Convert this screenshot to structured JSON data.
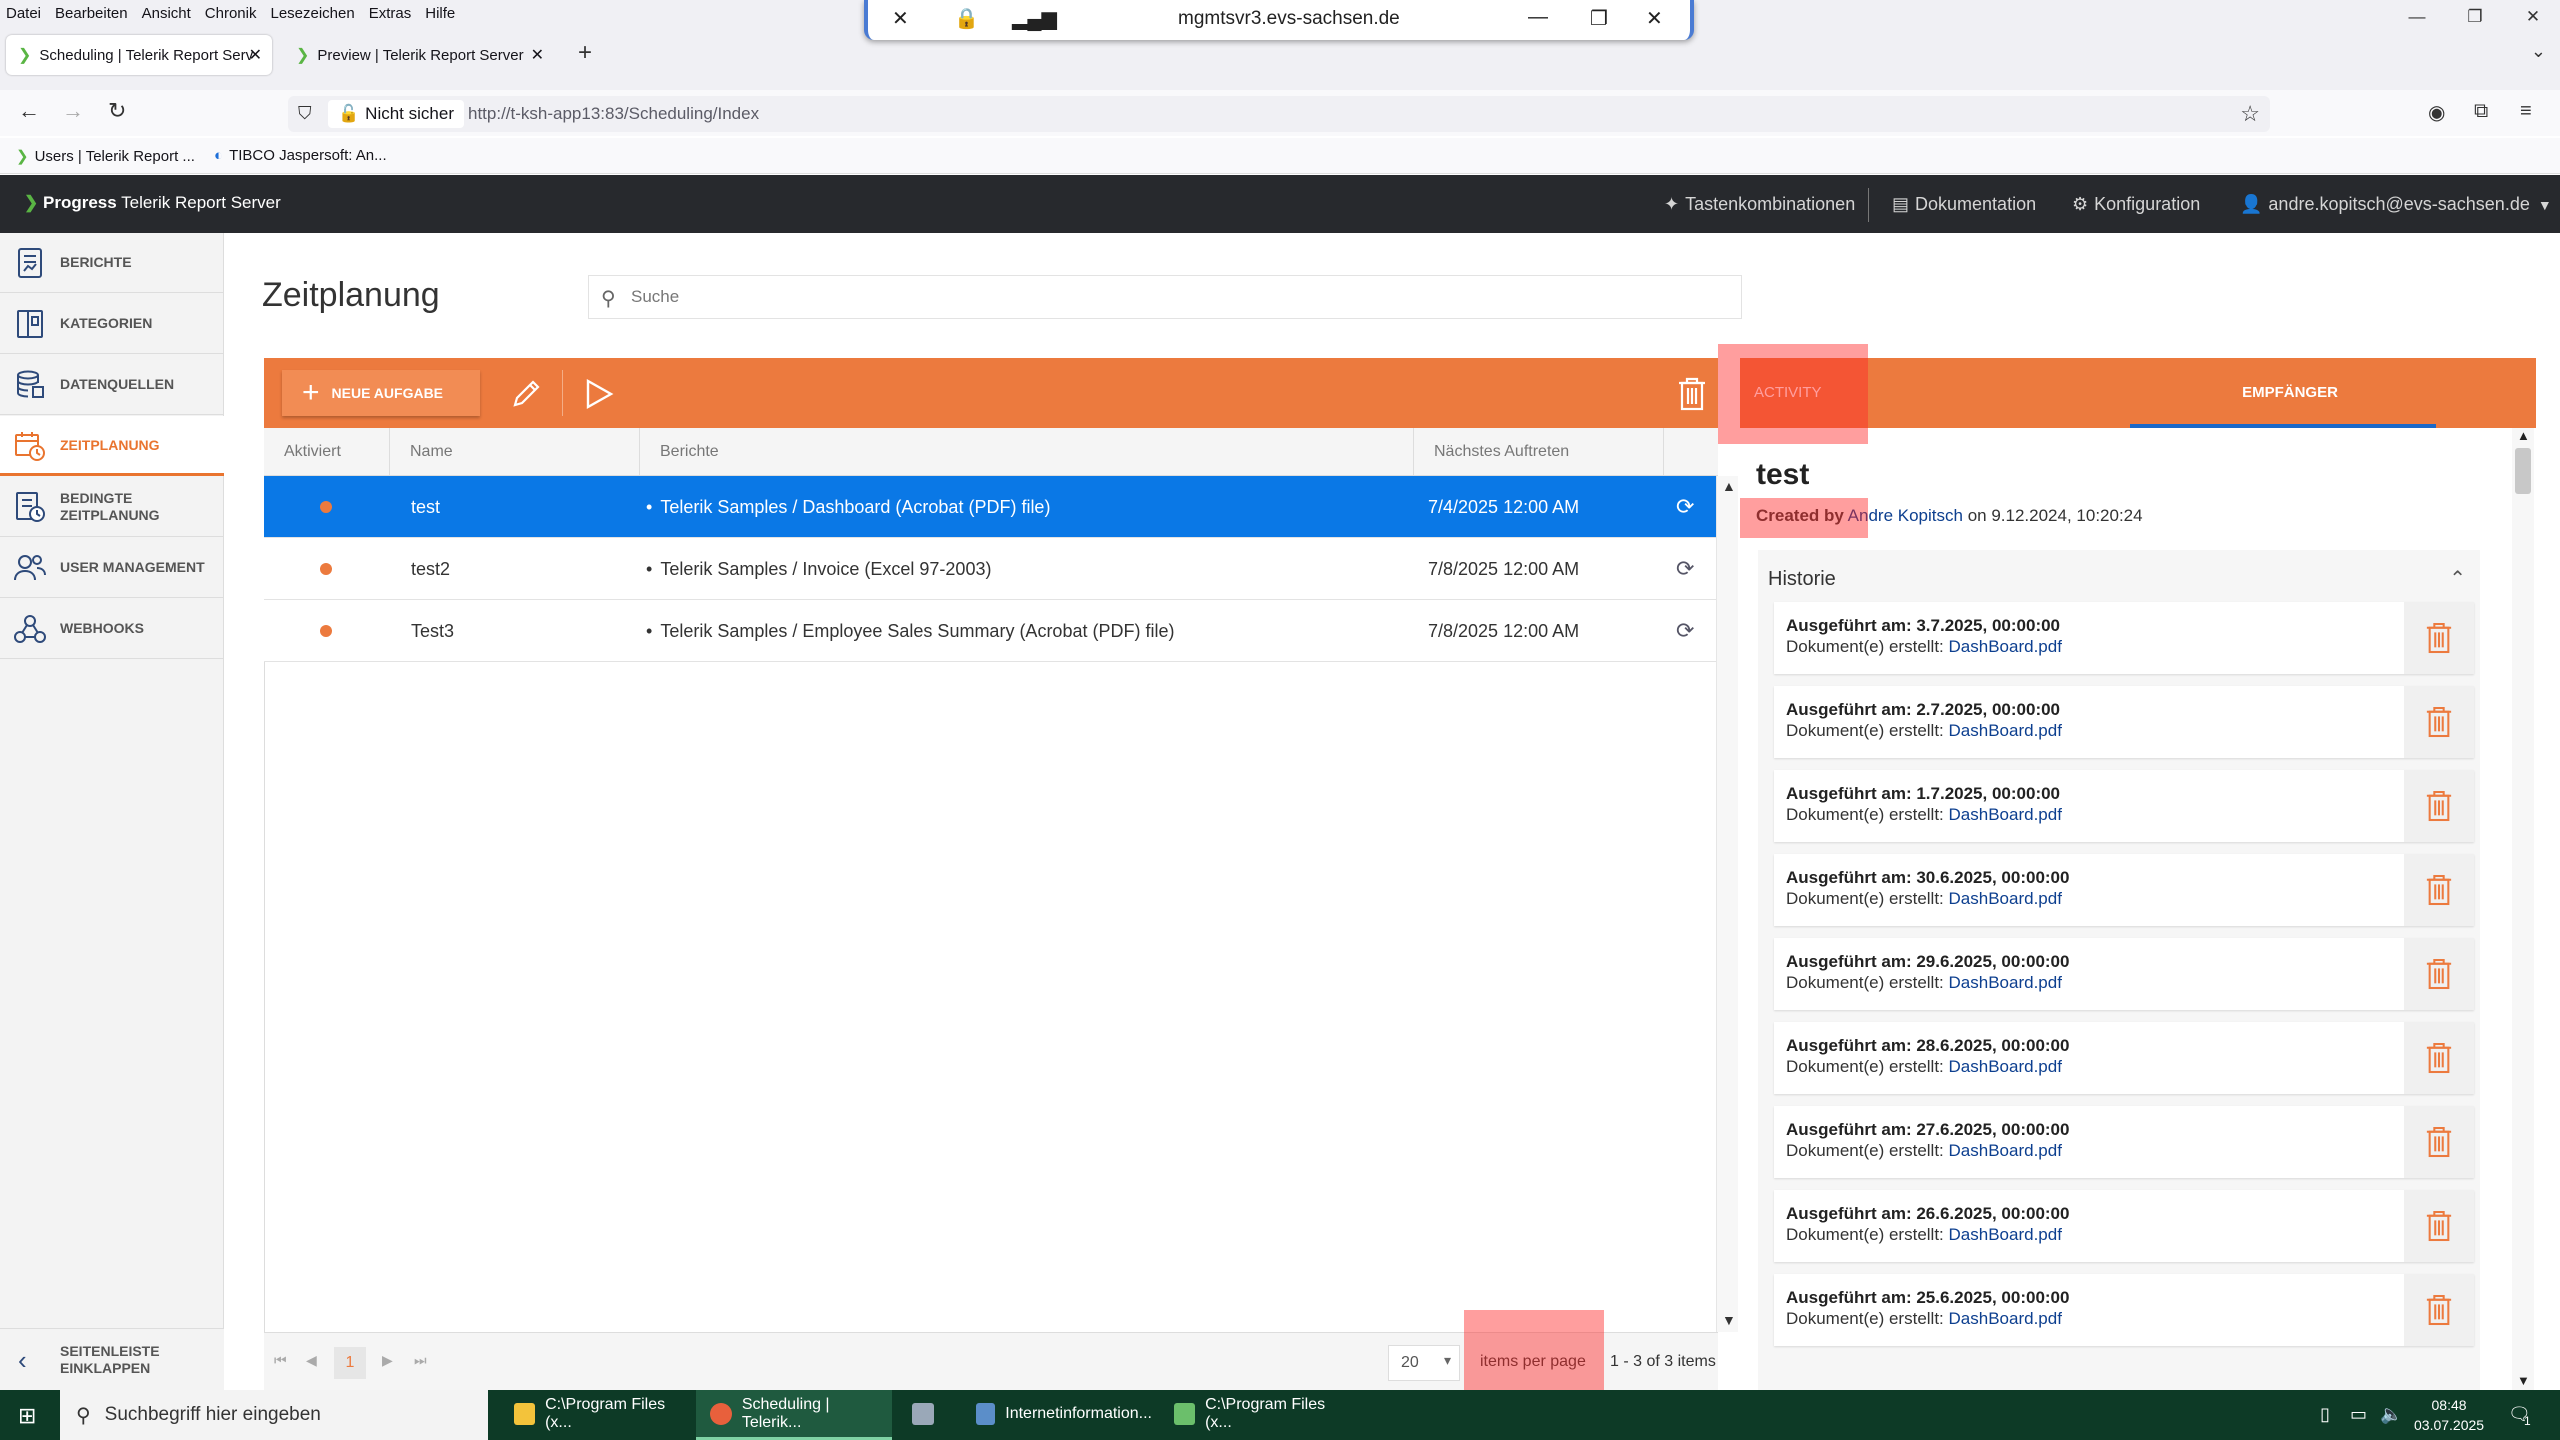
{
  "browser": {
    "menu": [
      "Datei",
      "Bearbeiten",
      "Ansicht",
      "Chronik",
      "Lesezeichen",
      "Extras",
      "Hilfe"
    ],
    "remote_host": "mgmtsvr3.evs-sachsen.de",
    "tabs": [
      {
        "title": "Scheduling | Telerik Report Serv",
        "active": true
      },
      {
        "title": "Preview | Telerik Report Server",
        "active": false
      }
    ],
    "security_label": "Nicht sicher",
    "url": "http://t-ksh-app13:83/Scheduling/Index",
    "bookmarks": [
      "Users | Telerik Report ...",
      "TIBCO Jaspersoft: An..."
    ]
  },
  "header": {
    "brand_logo": "Progress",
    "brand_product": "Telerik Report Server",
    "shortcuts": "Tastenkombinationen",
    "docs": "Dokumentation",
    "config": "Konfiguration",
    "user": "andre.kopitsch@evs-sachsen.de"
  },
  "sidebar": {
    "items": [
      {
        "line1": "BERICHTE",
        "line2": ""
      },
      {
        "line1": "KATEGORIEN",
        "line2": ""
      },
      {
        "line1": "DATENQUELLEN",
        "line2": ""
      },
      {
        "line1": "ZEITPLANUNG",
        "line2": ""
      },
      {
        "line1": "BEDINGTE",
        "line2": "ZEITPLANUNG"
      },
      {
        "line1": "USER MANAGEMENT",
        "line2": ""
      },
      {
        "line1": "WEBHOOKS",
        "line2": ""
      }
    ],
    "collapse_line1": "SEITENLEISTE",
    "collapse_line2": "EINKLAPPEN"
  },
  "main": {
    "title": "Zeitplanung",
    "search_placeholder": "Suche",
    "new_task": "NEUE AUFGABE",
    "columns": [
      "Aktiviert",
      "Name",
      "Berichte",
      "Nächstes Auftreten"
    ],
    "rows": [
      {
        "name": "test",
        "report": "Telerik Samples / Dashboard (Acrobat (PDF) file)",
        "next": "7/4/2025 12:00 AM",
        "selected": true
      },
      {
        "name": "test2",
        "report": "Telerik Samples / Invoice (Excel 97-2003)",
        "next": "7/8/2025 12:00 AM",
        "selected": false
      },
      {
        "name": "Test3",
        "report": "Telerik Samples / Employee Sales Summary (Acrobat (PDF) file)",
        "next": "7/8/2025 12:00 AM",
        "selected": false
      }
    ],
    "pager": {
      "page": "1",
      "page_size": "20",
      "label": "items per page",
      "info": "1 - 3 of 3 items"
    }
  },
  "detail": {
    "tabs": [
      "ACTIVITY",
      "EMPFÄNGER"
    ],
    "title": "test",
    "created_label": "Created by",
    "created_user": "Andre Kopitsch",
    "created_date": "on 9.12.2024, 10:20:24",
    "history_title": "Historie",
    "run_prefix": "Ausgeführt am:",
    "doc_prefix": "Dokument(e) erstellt:",
    "history": [
      {
        "date": "Ausgeführt am: 3.7.2025, 00:00:00",
        "file": "DashBoard.pdf"
      },
      {
        "date": "Ausgeführt am: 2.7.2025, 00:00:00",
        "file": "DashBoard.pdf"
      },
      {
        "date": "Ausgeführt am: 1.7.2025, 00:00:00",
        "file": "DashBoard.pdf"
      },
      {
        "date": "Ausgeführt am: 30.6.2025, 00:00:00",
        "file": "DashBoard.pdf"
      },
      {
        "date": "Ausgeführt am: 29.6.2025, 00:00:00",
        "file": "DashBoard.pdf"
      },
      {
        "date": "Ausgeführt am: 28.6.2025, 00:00:00",
        "file": "DashBoard.pdf"
      },
      {
        "date": "Ausgeführt am: 27.6.2025, 00:00:00",
        "file": "DashBoard.pdf"
      },
      {
        "date": "Ausgeführt am: 26.6.2025, 00:00:00",
        "file": "DashBoard.pdf"
      },
      {
        "date": "Ausgeführt am: 25.6.2025, 00:00:00",
        "file": "DashBoard.pdf"
      }
    ]
  },
  "taskbar": {
    "search_placeholder": "Suchbegriff hier eingeben",
    "apps": [
      "C:\\Program Files (x...",
      "Scheduling | Telerik...",
      "",
      "Internetinformation...",
      "C:\\Program Files (x..."
    ],
    "time": "08:48",
    "date": "03.07.2025",
    "notifications": "1"
  },
  "colors": {
    "accent": "#ec7a3e",
    "selection": "#0a78e6",
    "header_bg": "#27292d",
    "taskbar_bg": "#0d3a26"
  }
}
